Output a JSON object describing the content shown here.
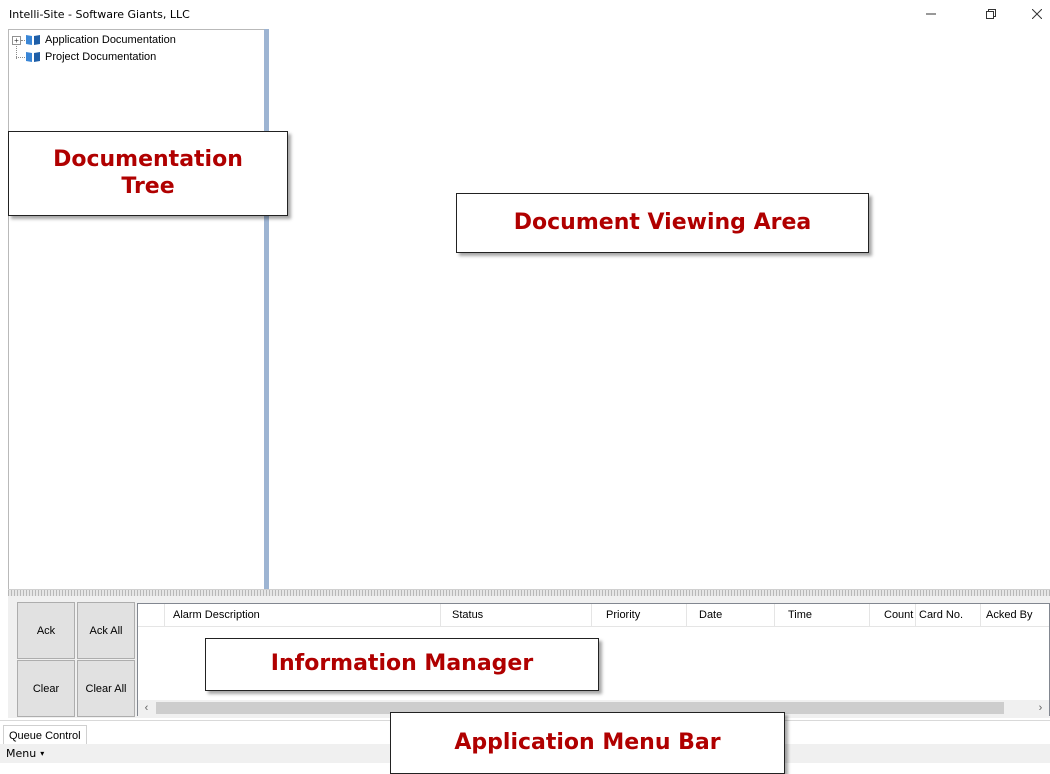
{
  "window": {
    "title": "Intelli-Site - Software Giants, LLC",
    "buttons": {
      "minimize": "minimize-icon",
      "maximize": "restore-icon",
      "close": "close-icon"
    }
  },
  "tree": {
    "items": [
      {
        "label": "Application Documentation",
        "expander": "⊞",
        "icon": "book-icon"
      },
      {
        "label": "Project Documentation",
        "icon": "book-icon"
      }
    ]
  },
  "callouts": {
    "tree": "Documentation Tree",
    "viewer": "Document Viewing Area",
    "info": "Information Manager",
    "menubar": "Application Menu Bar"
  },
  "queue": {
    "ack": "Ack",
    "ack_all": "Ack All",
    "clear": "Clear",
    "clear_all": "Clear All"
  },
  "grid": {
    "columns": [
      "Alarm Description",
      "Status",
      "Priority",
      "Date",
      "Time",
      "Count",
      "Card No.",
      "Acked By"
    ],
    "scroll_left": "‹",
    "scroll_right": "›"
  },
  "tabs": [
    "Queue Control"
  ],
  "menu": {
    "label": "Menu",
    "caret": "▾"
  },
  "colors": {
    "callout_text": "#b00000",
    "splitter": "#9db4d2"
  }
}
